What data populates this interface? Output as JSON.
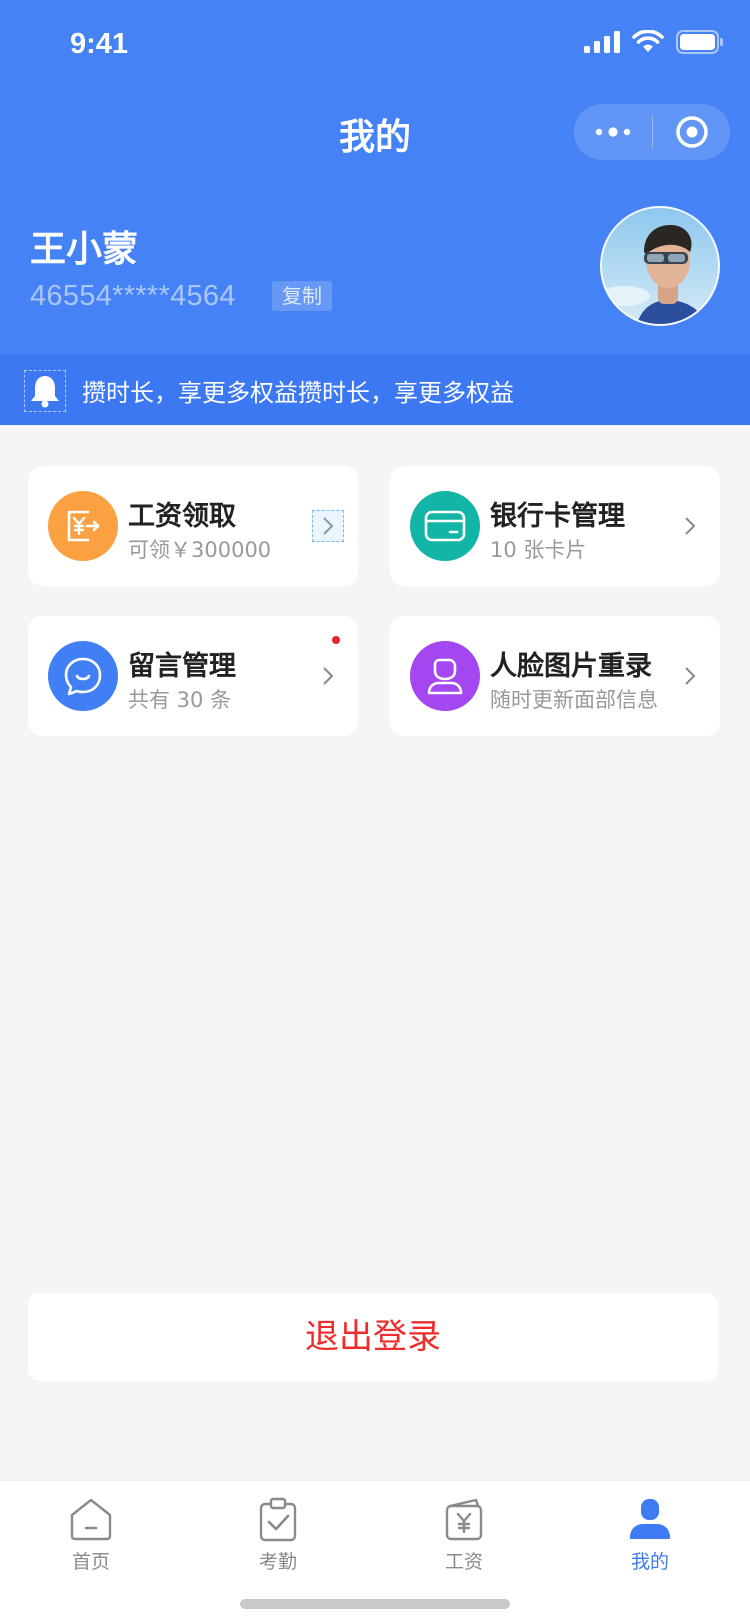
{
  "status_bar": {
    "time": "9:41"
  },
  "nav": {
    "title": "我的",
    "more_icon": "more-dots-icon",
    "close_icon": "record-target-icon"
  },
  "profile": {
    "name": "王小蒙",
    "id_masked": "46554*****4564",
    "copy_label": "复制",
    "avatar_icon": "user-avatar-photo"
  },
  "notice": {
    "text": "攒时长，享更多权益攒时长，享更多权益",
    "icon": "bell-icon"
  },
  "cards": [
    {
      "title": "工资领取",
      "sub": "可领￥300000",
      "color": "#fca142",
      "icon": "salary-transfer-icon"
    },
    {
      "title": "银行卡管理",
      "sub": "10 张卡片",
      "color": "#13b5a6",
      "icon": "bank-card-icon"
    },
    {
      "title": "留言管理",
      "sub": "共有 30 条",
      "color": "#4080f4",
      "icon": "message-bubble-icon",
      "has_dot": true
    },
    {
      "title": "人脸图片重录",
      "sub": "随时更新面部信息",
      "color": "#a447f0",
      "icon": "face-person-icon"
    }
  ],
  "logout": {
    "label": "退出登录"
  },
  "tabbar": {
    "items": [
      {
        "label": "首页",
        "icon": "home-icon",
        "active": false
      },
      {
        "label": "考勤",
        "icon": "attendance-clipboard-icon",
        "active": false
      },
      {
        "label": "工资",
        "icon": "salary-wallet-icon",
        "active": false
      },
      {
        "label": "我的",
        "icon": "profile-person-icon",
        "active": true
      }
    ]
  },
  "colors": {
    "primary": "#4582f5",
    "danger": "#ee2c2c",
    "active_tab": "#3f7cf4"
  }
}
